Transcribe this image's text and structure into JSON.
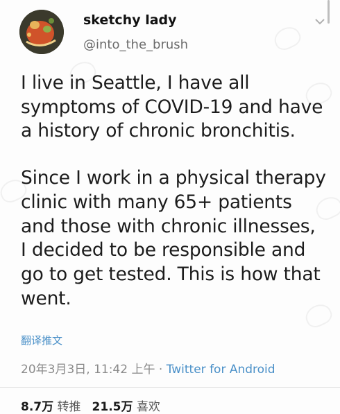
{
  "tweet": {
    "display_name": "sketchy lady",
    "handle": "@into_the_brush",
    "paragraphs": [
      "I live in Seattle, I have all symptoms of COVID-19 and have a history of chronic bronchitis.",
      "Since I work in a physical therapy clinic with many 65+ patients and those with chronic illnesses, I decided to be responsible and go to get tested. This is how that went."
    ],
    "translate_label": "翻译推文",
    "timestamp": "20年3月3日, 11:42 上午",
    "separator": " · ",
    "source": "Twitter for Android",
    "retweets_count": "8.7万",
    "retweets_label": "转推",
    "likes_count": "21.5万",
    "likes_label": "喜欢"
  },
  "icons": {
    "avatar": "avatar-image",
    "caret": "chevron-down-icon"
  },
  "colors": {
    "link": "#4a90c8",
    "secondary_text": "#6b6b6b",
    "primary_text": "#1c1c1c"
  }
}
